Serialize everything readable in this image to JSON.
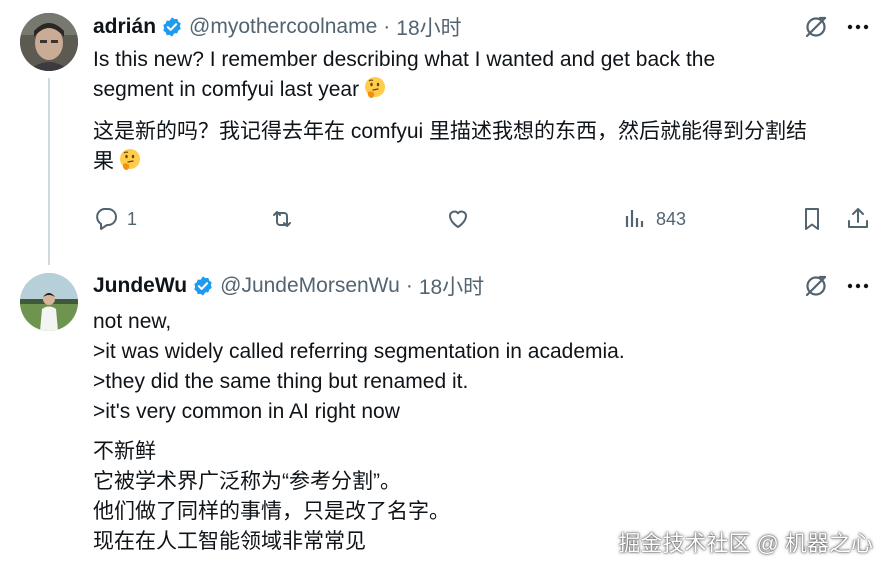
{
  "tweet1": {
    "display_name": "adrián",
    "handle": "@myothercoolname",
    "separator": "·",
    "time": "18小时",
    "text_en_line1": "Is this new? I remember describing what I wanted and get back the",
    "text_en_line2": "segment in comfyui last year",
    "text_zh_line1": "这是新的吗？我记得去年在 comfyui 里描述我想的东西，然后就能得到分割结",
    "text_zh_line2": "果",
    "emoji": "thinking-face-icon",
    "actions": {
      "reply_count": "1",
      "retweet_count": "",
      "like_count": "",
      "views_count": "843"
    }
  },
  "tweet2": {
    "display_name": "JundeWu",
    "handle": "@JundeMorsenWu",
    "separator": "·",
    "time": "18小时",
    "text_en_lines": [
      "not new,",
      ">it was widely called referring segmentation in academia.",
      ">they did the same thing but renamed it.",
      ">it's very common in AI right now"
    ],
    "text_zh_lines": [
      "不新鲜",
      "它被学术界广泛称为“参考分割”。",
      "他们做了同样的事情，只是改了名字。",
      "现在在人工智能领域非常常见"
    ]
  },
  "watermark": "掘金技术社区 @ 机器之心",
  "colors": {
    "text": "#0f1419",
    "secondary": "#536471",
    "verified": "#1d9bf0",
    "thread_line": "#cfd9de"
  }
}
